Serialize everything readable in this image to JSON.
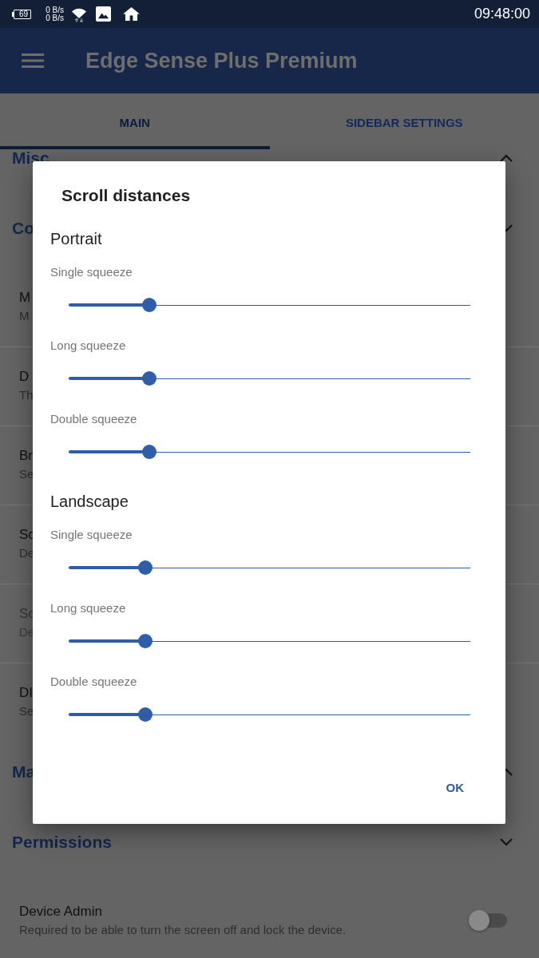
{
  "status_bar": {
    "battery": "69",
    "network_speeds": [
      "0 B/s",
      "0 B/s"
    ],
    "time": "09:48:00"
  },
  "app_bar": {
    "title": "Edge Sense Plus Premium"
  },
  "tabs": [
    {
      "label": "MAIN",
      "selected": true
    },
    {
      "label": "SIDEBAR SETTINGS",
      "selected": false
    }
  ],
  "settings": [
    {
      "kind": "header",
      "title": "Misc",
      "expanded": false
    },
    {
      "kind": "header",
      "title": "Co",
      "expanded": true
    },
    {
      "kind": "item",
      "title": "M",
      "subtitle": "M",
      "disabled": false
    },
    {
      "kind": "item",
      "title": "D",
      "subtitle": "Th",
      "disabled": false
    },
    {
      "kind": "item",
      "title": "Br",
      "subtitle": "Se",
      "disabled": false
    },
    {
      "kind": "item",
      "title": "Sc",
      "subtitle": "De",
      "disabled": false
    },
    {
      "kind": "item",
      "title": "Sc",
      "subtitle": "De",
      "disabled": true
    },
    {
      "kind": "item",
      "title": "DI",
      "subtitle": "Se",
      "disabled": false
    },
    {
      "kind": "header",
      "title": "Ma",
      "expanded": false
    },
    {
      "kind": "header",
      "title": "Permissions",
      "expanded": true
    },
    {
      "kind": "switch",
      "title": "Device Admin",
      "subtitle": "Required to be able to turn the screen off and lock the device.",
      "on": false,
      "disabled": false
    }
  ],
  "dialog": {
    "title": "Scroll distances",
    "sections": [
      {
        "title": "Portrait",
        "sliders": [
          {
            "label": "Single squeeze",
            "level": 0.2
          },
          {
            "label": "Long squeeze",
            "level": 0.2
          },
          {
            "label": "Double squeeze",
            "level": 0.2
          }
        ]
      },
      {
        "title": "Landscape",
        "sliders": [
          {
            "label": "Single squeeze",
            "level": 0.19
          },
          {
            "label": "Long squeeze",
            "level": 0.19
          },
          {
            "label": "Double squeeze",
            "level": 0.19
          }
        ]
      }
    ],
    "buttons": [
      "OK"
    ]
  }
}
